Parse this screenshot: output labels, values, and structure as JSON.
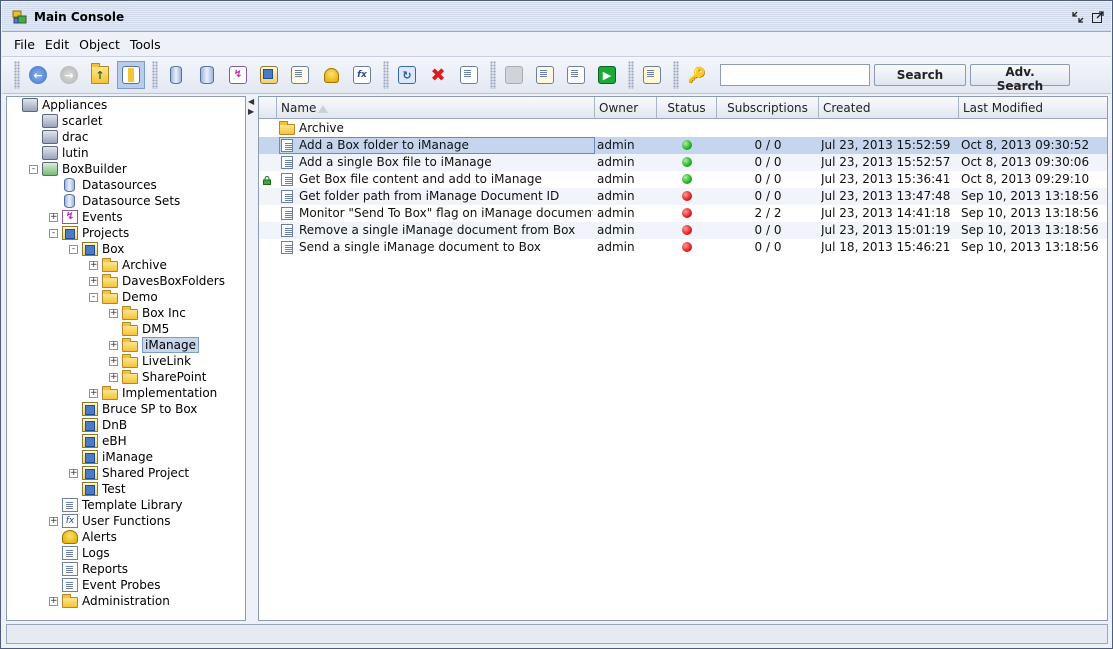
{
  "window": {
    "title": "Main Console"
  },
  "menu": [
    {
      "label": "File"
    },
    {
      "label": "Edit"
    },
    {
      "label": "Object"
    },
    {
      "label": "Tools"
    }
  ],
  "toolbar": {
    "buttons": [
      "back-icon",
      "forward-icon",
      "up-folder-icon",
      "panel-toggle-icon",
      "datasource-icon",
      "datasource-set-icon",
      "event-icon",
      "project-icon",
      "template-icon",
      "alert-icon",
      "function-icon",
      "refresh-icon",
      "delete-icon",
      "edit-icon",
      "run-disabled-icon",
      "subscribe-icon",
      "stop-icon",
      "play-icon",
      "properties-icon",
      "search-key-icon"
    ],
    "search_value": "",
    "search_button": "Search",
    "adv_search_button": "Adv. Search"
  },
  "tree": [
    {
      "label": "Appliances",
      "icon": "appliances",
      "level": 0,
      "expander": ""
    },
    {
      "label": "scarlet",
      "icon": "server",
      "level": 1,
      "expander": ""
    },
    {
      "label": "drac",
      "icon": "server",
      "level": 1,
      "expander": ""
    },
    {
      "label": "lutin",
      "icon": "server",
      "level": 1,
      "expander": ""
    },
    {
      "label": "BoxBuilder",
      "icon": "server-green",
      "level": 1,
      "expander": "-"
    },
    {
      "label": "Datasources",
      "icon": "db",
      "level": 2,
      "expander": ""
    },
    {
      "label": "Datasource Sets",
      "icon": "db",
      "level": 2,
      "expander": ""
    },
    {
      "label": "Events",
      "icon": "events",
      "level": 2,
      "expander": "+"
    },
    {
      "label": "Projects",
      "icon": "proj",
      "level": 2,
      "expander": "-"
    },
    {
      "label": "Box",
      "icon": "proj",
      "level": 3,
      "expander": "-"
    },
    {
      "label": "Archive",
      "icon": "folder",
      "level": 4,
      "expander": "+"
    },
    {
      "label": "DavesBoxFolders",
      "icon": "folder",
      "level": 4,
      "expander": "+"
    },
    {
      "label": "Demo",
      "icon": "folder",
      "level": 4,
      "expander": "-"
    },
    {
      "label": "Box Inc",
      "icon": "folder",
      "level": 5,
      "expander": "+"
    },
    {
      "label": "DM5",
      "icon": "folder",
      "level": 5,
      "expander": ""
    },
    {
      "label": "iManage",
      "icon": "folder",
      "level": 5,
      "expander": "+",
      "selected": true
    },
    {
      "label": "LiveLink",
      "icon": "folder",
      "level": 5,
      "expander": "+"
    },
    {
      "label": "SharePoint",
      "icon": "folder",
      "level": 5,
      "expander": "+"
    },
    {
      "label": "Implementation",
      "icon": "folder",
      "level": 4,
      "expander": "+"
    },
    {
      "label": "Bruce SP to Box",
      "icon": "proj",
      "level": 3,
      "expander": ""
    },
    {
      "label": "DnB",
      "icon": "proj",
      "level": 3,
      "expander": ""
    },
    {
      "label": "eBH",
      "icon": "proj",
      "level": 3,
      "expander": ""
    },
    {
      "label": "iManage",
      "icon": "proj",
      "level": 3,
      "expander": ""
    },
    {
      "label": "Shared Project",
      "icon": "proj",
      "level": 3,
      "expander": "+"
    },
    {
      "label": "Test",
      "icon": "proj",
      "level": 3,
      "expander": ""
    },
    {
      "label": "Template Library",
      "icon": "template",
      "level": 2,
      "expander": ""
    },
    {
      "label": "User Functions",
      "icon": "fx",
      "level": 2,
      "expander": "+"
    },
    {
      "label": "Alerts",
      "icon": "bell",
      "level": 2,
      "expander": ""
    },
    {
      "label": "Logs",
      "icon": "logs",
      "level": 2,
      "expander": ""
    },
    {
      "label": "Reports",
      "icon": "reports",
      "level": 2,
      "expander": ""
    },
    {
      "label": "Event Probes",
      "icon": "probes",
      "level": 2,
      "expander": ""
    },
    {
      "label": "Administration",
      "icon": "folder",
      "level": 2,
      "expander": "+"
    }
  ],
  "table": {
    "columns": [
      "Name",
      "Owner",
      "Status",
      "Subscriptions",
      "Created",
      "Last Modified"
    ],
    "folder_row": "Archive",
    "rows": [
      {
        "name": "Add a Box folder to iManage",
        "owner": "admin",
        "status": "green",
        "subs": "0 / 0",
        "created": "Jul 23, 2013 15:52:59",
        "modified": "Oct 8, 2013 09:30:52",
        "selected": true,
        "locked": false
      },
      {
        "name": "Add a single Box file to iManage",
        "owner": "admin",
        "status": "green",
        "subs": "0 / 0",
        "created": "Jul 23, 2013 15:52:57",
        "modified": "Oct 8, 2013 09:30:06",
        "locked": false
      },
      {
        "name": "Get Box file content and add to iManage",
        "owner": "admin",
        "status": "green",
        "subs": "0 / 0",
        "created": "Jul 23, 2013 15:36:41",
        "modified": "Oct 8, 2013 09:29:10",
        "locked": true
      },
      {
        "name": "Get folder path from iManage Document ID",
        "owner": "admin",
        "status": "red",
        "subs": "0 / 0",
        "created": "Jul 23, 2013 13:47:48",
        "modified": "Sep 10, 2013 13:18:56",
        "locked": false
      },
      {
        "name": "Monitor \"Send To Box\" flag on iManage documents",
        "owner": "admin",
        "status": "red",
        "subs": "2 / 2",
        "created": "Jul 23, 2013 14:41:18",
        "modified": "Sep 10, 2013 13:18:56",
        "locked": false
      },
      {
        "name": "Remove a single iManage document from Box",
        "owner": "admin",
        "status": "red",
        "subs": "0 / 0",
        "created": "Jul 23, 2013 15:01:19",
        "modified": "Sep 10, 2013 13:18:56",
        "locked": false
      },
      {
        "name": "Send a single iManage document to Box",
        "owner": "admin",
        "status": "red",
        "subs": "0 / 0",
        "created": "Jul 18, 2013 15:46:21",
        "modified": "Sep 10, 2013 13:18:56",
        "locked": false
      }
    ]
  },
  "status_bar": {
    "text": ""
  }
}
